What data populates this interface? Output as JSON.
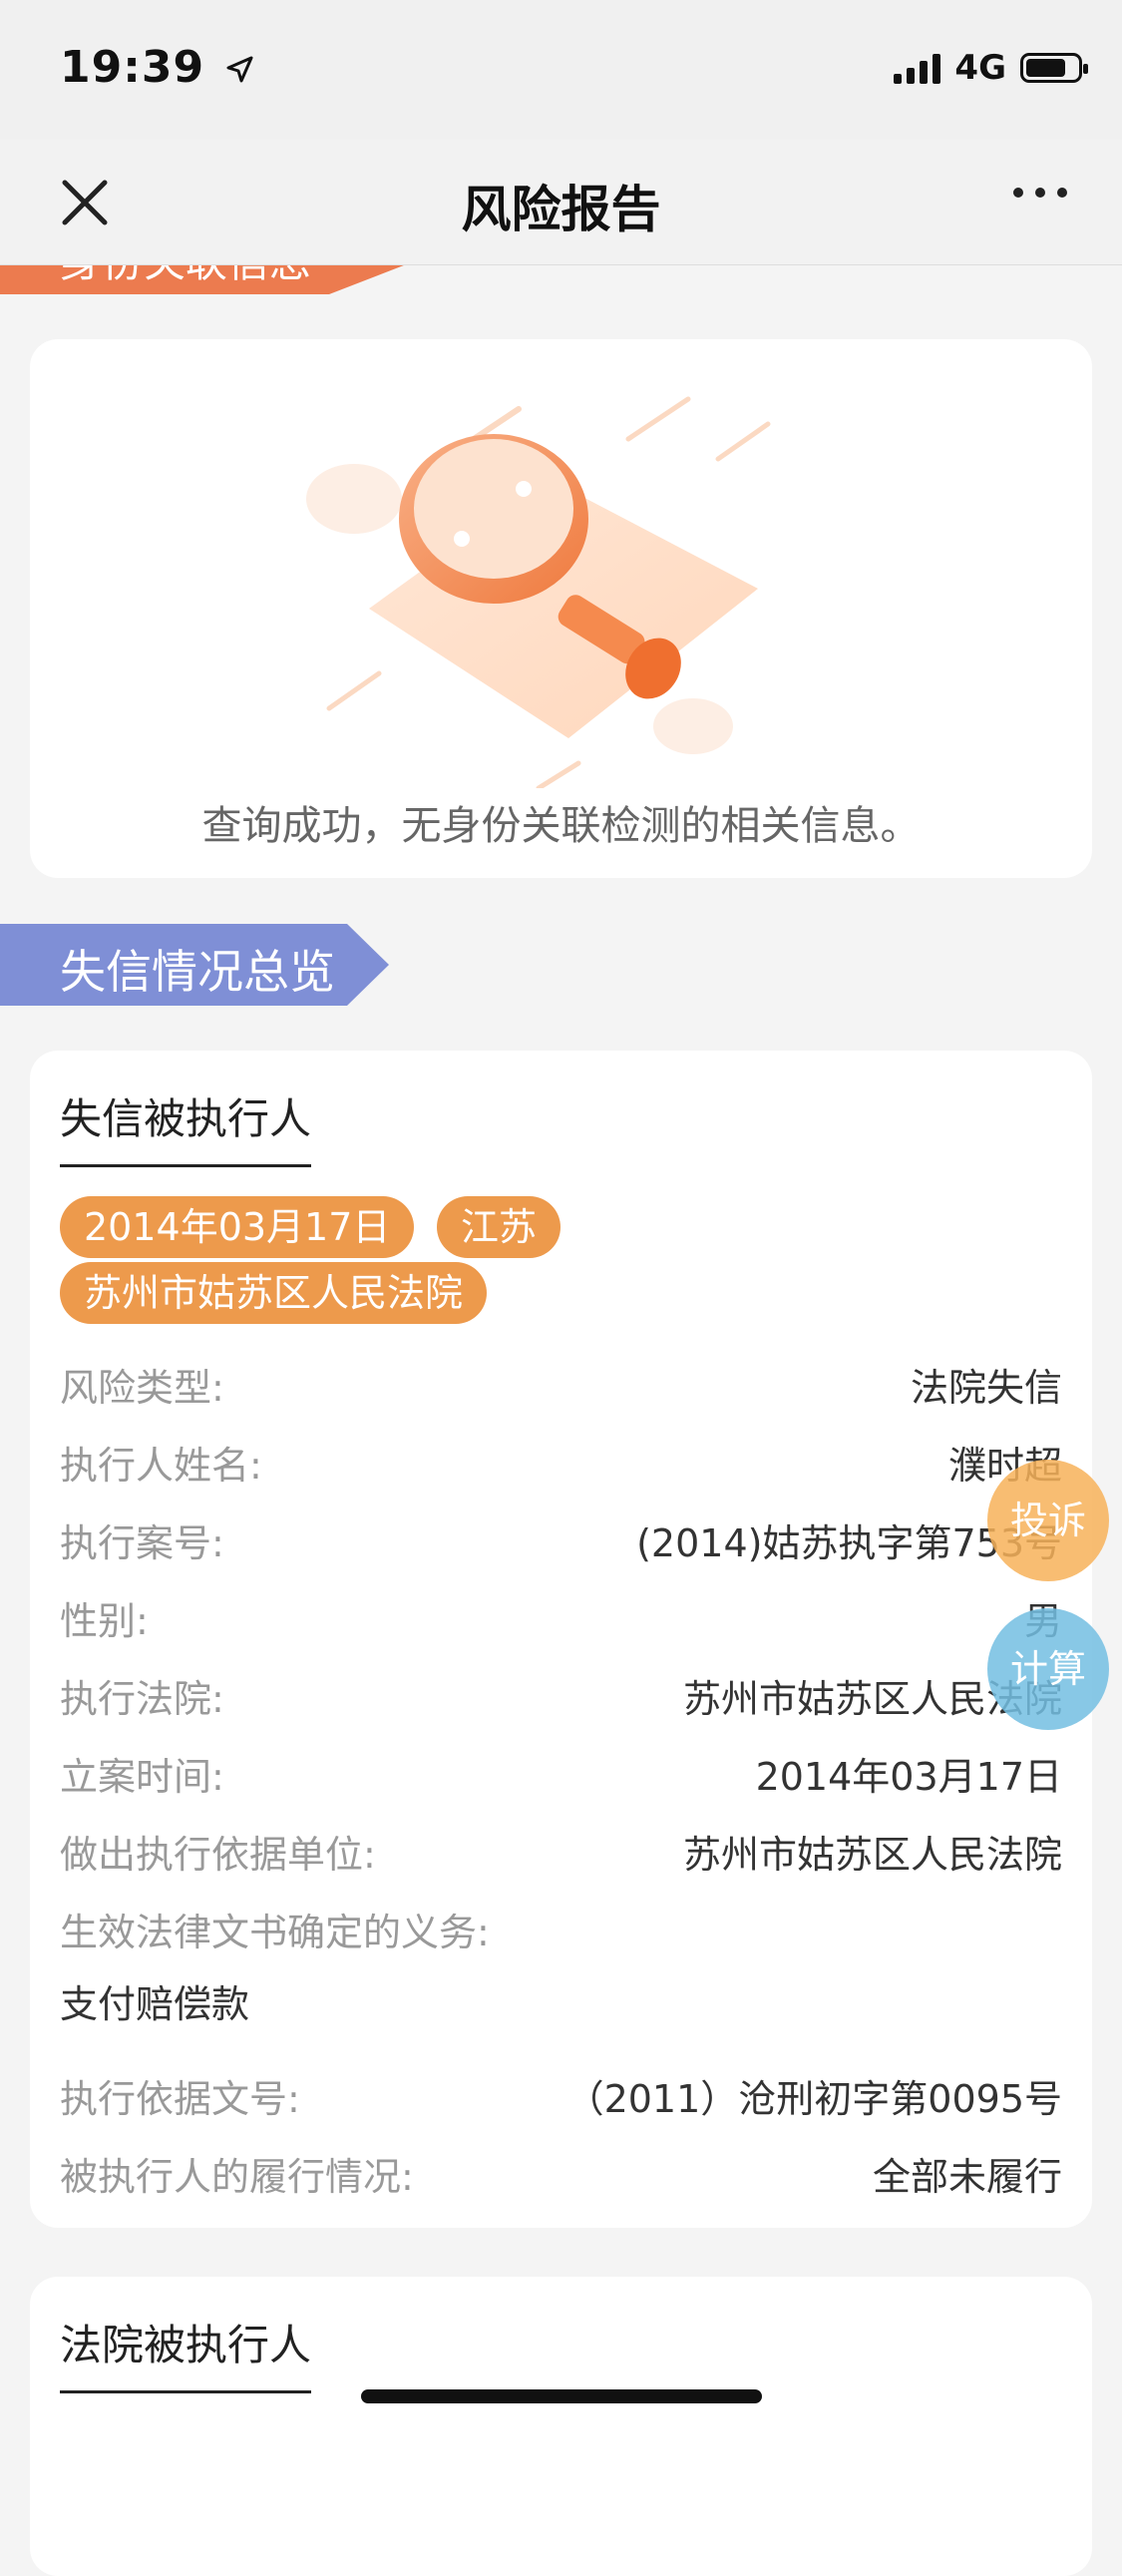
{
  "status": {
    "time": "19:39",
    "network": "4G"
  },
  "nav": {
    "title": "风险报告"
  },
  "scrolled_section": {
    "title": "身份关联信息"
  },
  "empty_state": {
    "message": "查询成功，无身份关联检测的相关信息。"
  },
  "overview_section": {
    "title": "失信情况总览"
  },
  "dishonest_card": {
    "title": "失信被执行人",
    "tags": [
      "2014年03月17日",
      "江苏",
      "苏州市姑苏区人民法院"
    ],
    "rows": [
      {
        "label": "风险类型:",
        "value": "法院失信"
      },
      {
        "label": "执行人姓名:",
        "value": "濮时超"
      },
      {
        "label": "执行案号:",
        "value": "(2014)姑苏执字第753号"
      },
      {
        "label": "性别:",
        "value": "男"
      },
      {
        "label": "执行法院:",
        "value": "苏州市姑苏区人民法院"
      },
      {
        "label": "立案时间:",
        "value": "2014年03月17日"
      },
      {
        "label": "做出执行依据单位:",
        "value": "苏州市姑苏区人民法院"
      }
    ],
    "duty_label": "生效法律文书确定的义务:",
    "duty_value": "支付赔偿款",
    "rows2": [
      {
        "label": "执行依据文号:",
        "value": "（2011）沧刑初字第0095号"
      },
      {
        "label": "被执行人的履行情况:",
        "value": "全部未履行"
      }
    ]
  },
  "court_card": {
    "title": "法院被执行人"
  },
  "float_buttons": {
    "complain": "投诉",
    "calc": "计算"
  }
}
